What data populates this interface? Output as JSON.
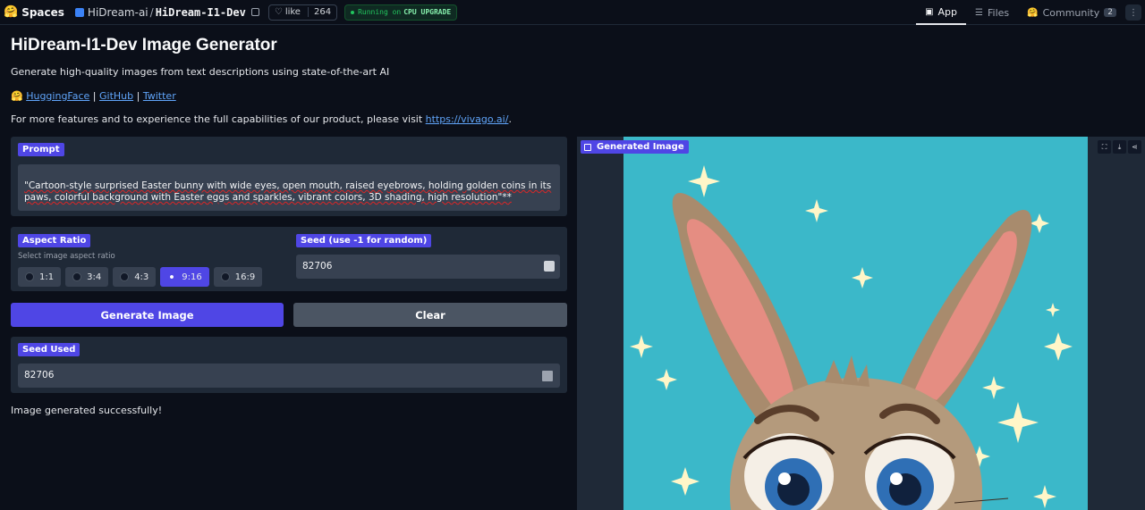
{
  "topbar": {
    "spaces_label": "Spaces",
    "owner": "HiDream-ai",
    "repo": "HiDream-I1-Dev",
    "like_label": "like",
    "like_count": "264",
    "running_label": "Running on",
    "hardware": "CPU UPGRADE",
    "nav": [
      {
        "label": "App",
        "icon": "app-icon"
      },
      {
        "label": "Files",
        "icon": "files-icon"
      },
      {
        "label": "Community",
        "icon": "community-icon",
        "badge": "2"
      }
    ],
    "more_label": "⋮"
  },
  "page": {
    "title": "HiDream-I1-Dev Image Generator",
    "subtitle": "Generate high-quality images from text descriptions using state-of-the-art AI",
    "links": {
      "emoji": "🤗",
      "huggingface": "HuggingFace",
      "github": "GitHub",
      "twitter": "Twitter",
      "separator": "|"
    },
    "visit_text": "For more features and to experience the full capabilities of our product, please visit",
    "visit_link": "https://vivago.ai/",
    "visit_end": "."
  },
  "prompt": {
    "label": "Prompt",
    "value": "\"Cartoon-style surprised Easter bunny with wide eyes, open mouth, raised eyebrows, holding golden coins in its paws, colorful background with Easter eggs and sparkles, vibrant colors, 3D shading, high resolution\"**"
  },
  "aspect_ratio": {
    "label": "Aspect Ratio",
    "hint": "Select image aspect ratio",
    "options": [
      "1:1",
      "3:4",
      "4:3",
      "9:16",
      "16:9"
    ],
    "selected": "9:16"
  },
  "seed": {
    "label": "Seed (use -1 for random)",
    "value": "82706"
  },
  "buttons": {
    "generate": "Generate Image",
    "clear": "Clear"
  },
  "seed_used": {
    "label": "Seed Used",
    "value": "82706"
  },
  "status": "Image generated successfully!",
  "output": {
    "label": "Generated Image",
    "actions": [
      "fullscreen-icon",
      "download-icon",
      "share-icon"
    ],
    "colors": {
      "background": "#3bb8c9",
      "fur": "#a88b6d",
      "inner_ear": "#e58d82"
    }
  }
}
